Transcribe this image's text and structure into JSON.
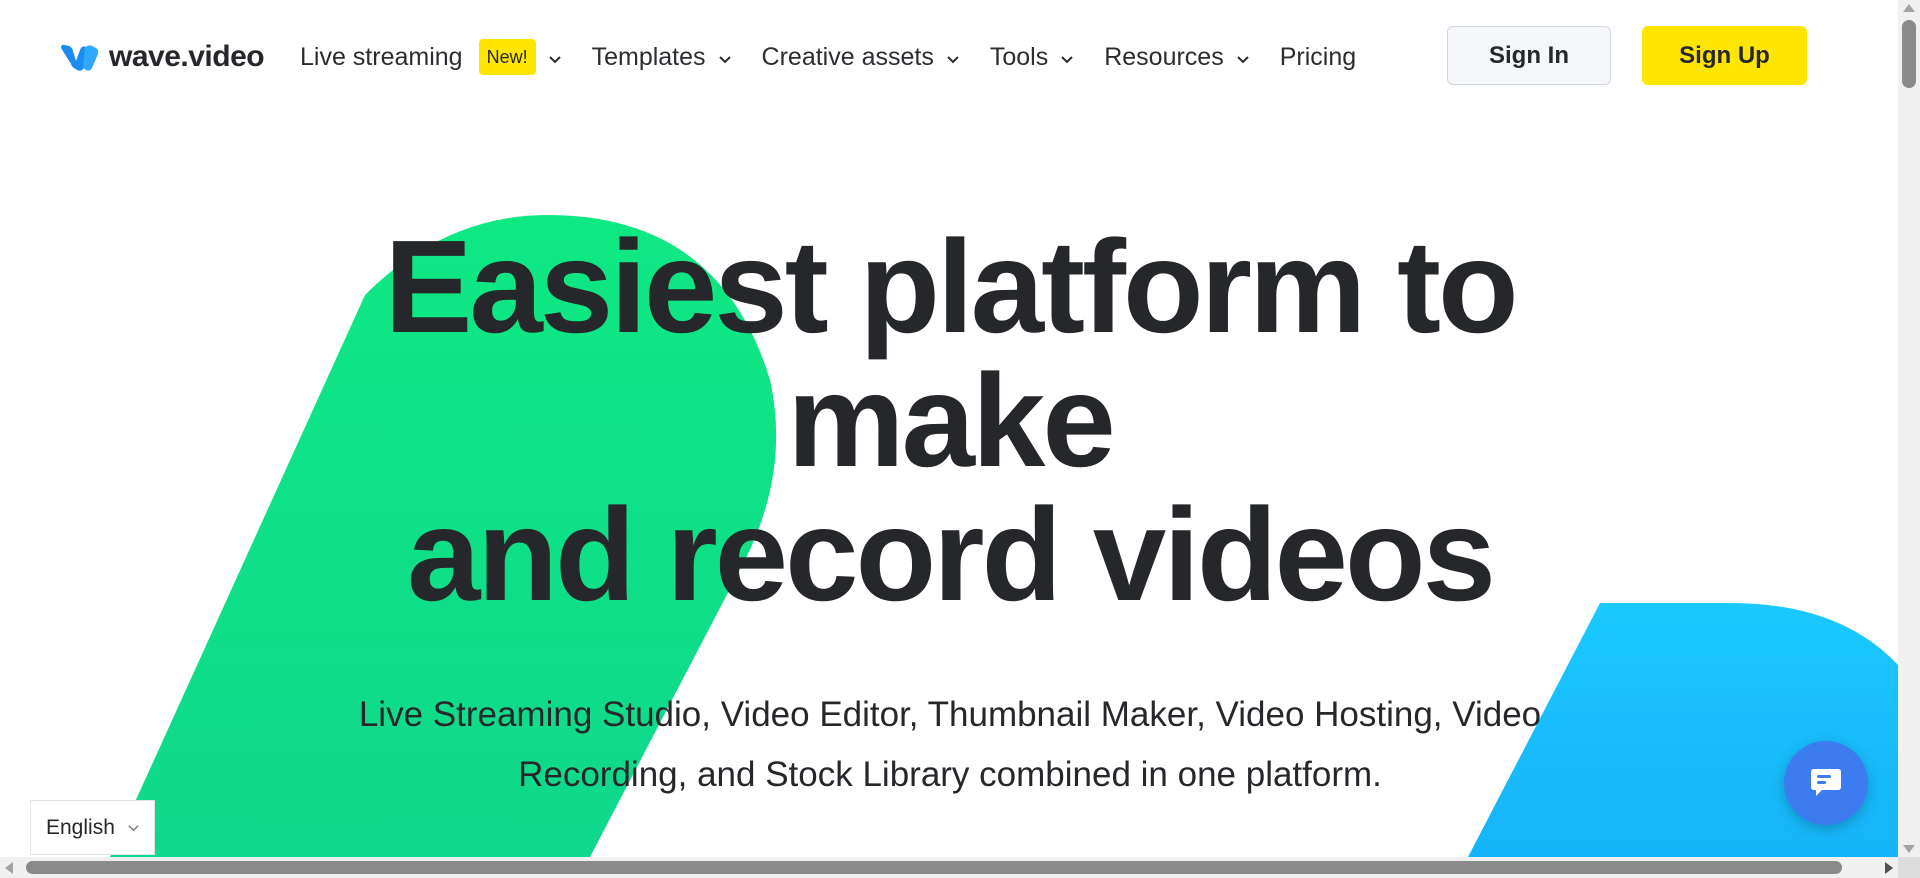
{
  "brand": {
    "name": "wave.video",
    "accent_yellow": "#FFE600",
    "green": "#0EE882",
    "blue": "#1BC6FF",
    "chat_blue": "#3D7CF0"
  },
  "nav": {
    "items": [
      {
        "label": "Live streaming",
        "badge": "New!",
        "has_dropdown": true
      },
      {
        "label": "Templates",
        "has_dropdown": true
      },
      {
        "label": "Creative assets",
        "has_dropdown": true
      },
      {
        "label": "Tools",
        "has_dropdown": true
      },
      {
        "label": "Resources",
        "has_dropdown": true
      },
      {
        "label": "Pricing",
        "has_dropdown": false
      }
    ]
  },
  "auth": {
    "sign_in": "Sign In",
    "sign_up": "Sign Up"
  },
  "hero": {
    "title_line1": "Easiest platform to",
    "title_line2": "make",
    "title_line3": "and record videos",
    "subtitle_line1": "Live Streaming Studio, Video Editor, Thumbnail Maker, Video Hosting, Video",
    "subtitle_line2": "Recording, and Stock Library combined in one platform."
  },
  "language": {
    "selected": "English"
  },
  "icons": [
    "wave-logo-icon",
    "chevron-down-icon",
    "chat-bubble-icon"
  ]
}
